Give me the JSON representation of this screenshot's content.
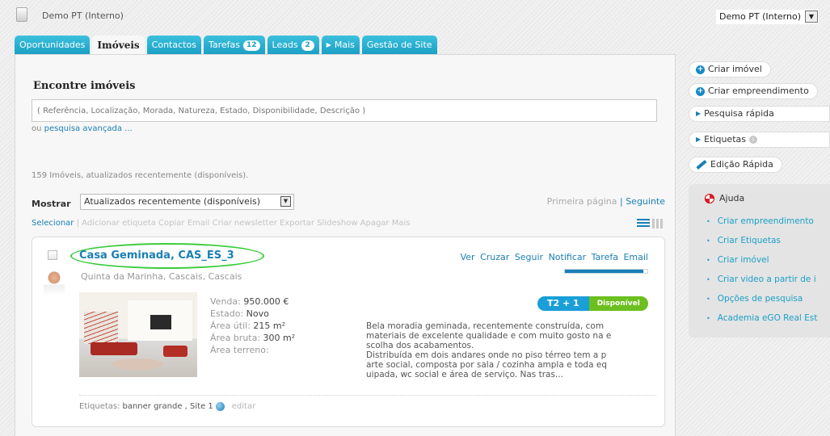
{
  "header": {
    "account_title": "Demo PT (Interno)",
    "account_select": "Demo PT (Interno)"
  },
  "tabs": [
    {
      "label": "Oportunidades"
    },
    {
      "label": "Imóveis",
      "active": true
    },
    {
      "label": "Contactos"
    },
    {
      "label": "Tarefas",
      "badge": "12"
    },
    {
      "label": "Leads",
      "badge": "2"
    },
    {
      "label": "Mais"
    },
    {
      "label": "Gestão de Site"
    }
  ],
  "search": {
    "title": "Encontre imóveis",
    "placeholder": "( Referência, Localização, Morada, Natureza, Estado, Disponibilidade, Descrição )",
    "advanced_prefix": "ou",
    "advanced_link": "pesquisa avançada ..."
  },
  "results": {
    "count_text": "159 Imóveis, atualizados recentemente (disponíveis).",
    "show_label": "Mostrar",
    "show_value": "Atualizados recentemente (disponíveis)",
    "pager": {
      "first": "Primeira página",
      "separator": "|",
      "next": "Seguinte"
    },
    "actions": [
      "Selecionar",
      "|",
      "Adicionar etiqueta",
      "Copiar",
      "Email",
      "Criar newsletter",
      "Exportar",
      "Slideshow",
      "Apagar",
      "Mais"
    ]
  },
  "property": {
    "title": "Casa Geminada, CAS_ES_3",
    "location": "Quinta da Marinha, Cascais, Cascais",
    "links": [
      "Ver",
      "Cruzar",
      "Seguir",
      "Notificar",
      "Tarefa",
      "Email"
    ],
    "progress": 0.95,
    "attributes": [
      {
        "label": "Venda:",
        "value": "950.000 €"
      },
      {
        "label": "Estado:",
        "value": "Novo"
      },
      {
        "label": "Área útil:",
        "value": "215 m²"
      },
      {
        "label": "Área bruta:",
        "value": "300 m²"
      },
      {
        "label": "Área terreno:",
        "value": ""
      }
    ],
    "typology": "T2 + 1",
    "availability": "Disponível",
    "description_lines": [
      "Bela moradia geminada, recentemente construída, com",
      "materiais de excelente qualidade e com muito gosto na e",
      "scolha dos acabamentos.",
      "Distribuída em dois andares onde no piso térreo tem a p",
      "arte social, composta por sala / cozinha ampla e toda eq",
      "uipada, wc social e área de serviço. Nas tras..."
    ],
    "labels_prefix": "Etiquetas:",
    "labels_value": "banner grande , Site 1",
    "edit_link": "editar"
  },
  "sidebar": {
    "create_property": "Criar imóvel",
    "create_development": "Criar empreendimento",
    "quick_search": "Pesquisa rápida",
    "tags": "Etiquetas",
    "quick_edit": "Edição Rápida",
    "help_title": "Ajuda",
    "help_links": [
      "Criar empreendimento",
      "Criar Etiquetas",
      "Criar imóvel",
      "Criar video a partir de i",
      "Opções de pesquisa",
      "Academia eGO Real Est"
    ]
  },
  "colors": {
    "tab_bg": "#1a9fc4",
    "link": "#1a7fb5",
    "typology_chip": "#1a9fd8",
    "availability_chip": "#6cbf1f",
    "highlight_ellipse": "#3ccd3c"
  }
}
